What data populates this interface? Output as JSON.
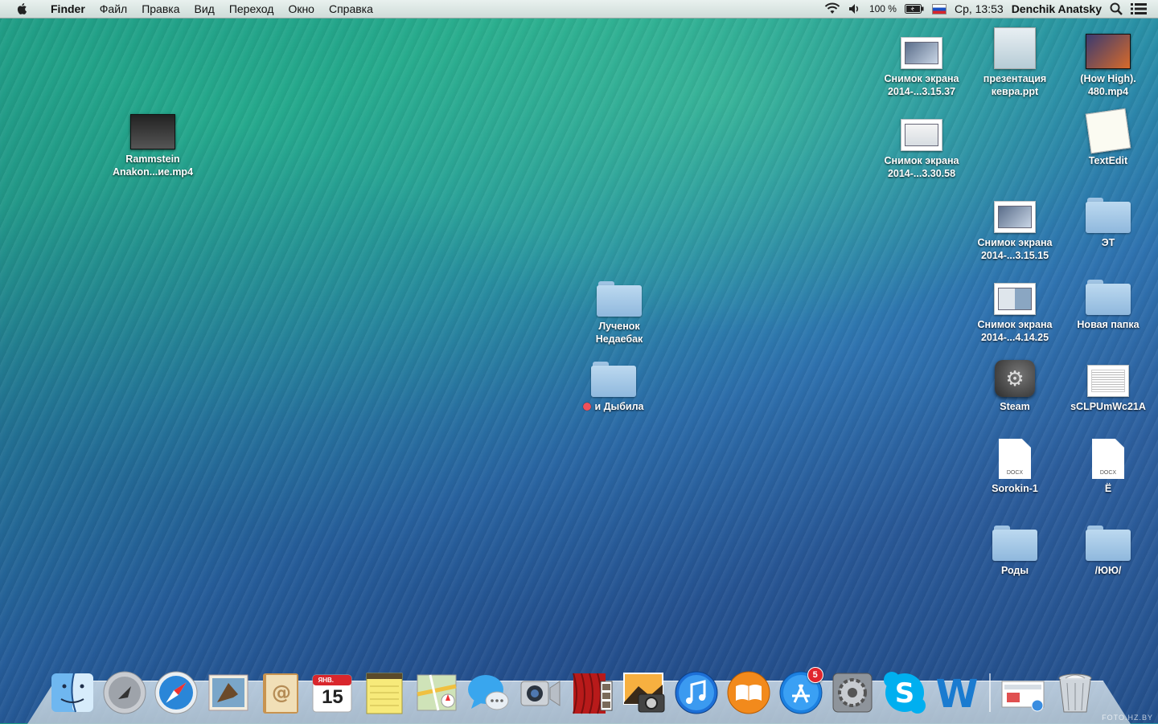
{
  "menubar": {
    "app_name": "Finder",
    "items": [
      "Файл",
      "Правка",
      "Вид",
      "Переход",
      "Окно",
      "Справка"
    ],
    "battery": "100 %",
    "clock": "Ср, 13:53",
    "user": "Denchik Anatsky"
  },
  "desktop": {
    "icons": [
      {
        "label": "Rammstein\nAnakon...ие.mp4",
        "kind": "video"
      },
      {
        "label": "Снимок экрана\n2014-...3.15.37",
        "kind": "screenshot"
      },
      {
        "label": "презентация\nкевра.ppt",
        "kind": "ppt"
      },
      {
        "label": "(How High).\n480.mp4",
        "kind": "video"
      },
      {
        "label": "Снимок экрана\n2014-...3.30.58",
        "kind": "screenshot"
      },
      {
        "label": "TextEdit",
        "kind": "app"
      },
      {
        "label": "Снимок экрана\n2014-...3.15.15",
        "kind": "screenshot"
      },
      {
        "label": "ЭТ",
        "kind": "folder"
      },
      {
        "label": "Снимок экрана\n2014-...4.14.25",
        "kind": "screenshot"
      },
      {
        "label": "Новая папка",
        "kind": "folder"
      },
      {
        "label": "Лученок\nНедаебак",
        "kind": "folder"
      },
      {
        "label": "и Дыбила",
        "kind": "folder",
        "tag_color": "#f0505a"
      },
      {
        "label": "Steam",
        "kind": "app"
      },
      {
        "label": "sCLPUmWc21A",
        "kind": "document"
      },
      {
        "label": "Sorokin-1",
        "kind": "docx"
      },
      {
        "label": "Ё",
        "kind": "docx"
      },
      {
        "label": "Роды",
        "kind": "folder"
      },
      {
        "label": "/ЮЮ/",
        "kind": "folder"
      }
    ],
    "docx_ext": "DOCX"
  },
  "dock": {
    "apps": [
      "finder-icon",
      "launchpad-icon",
      "safari-icon",
      "mail-icon",
      "contacts-icon",
      "calendar-icon",
      "notes-icon",
      "maps-icon",
      "messages-icon",
      "facetime-icon",
      "photo-booth-icon",
      "iphoto-icon",
      "itunes-icon",
      "ibooks-icon",
      "app-store-icon",
      "system-preferences-icon",
      "skype-icon",
      "word-icon"
    ],
    "calendar_month": "ЯНВ.",
    "calendar_day": "15",
    "app_store_badge": "5"
  },
  "watermark": "FOTO.HZ.BY",
  "colors": {
    "tag_red": "#f0505a",
    "menubar_bg": "#dfe8e6"
  }
}
